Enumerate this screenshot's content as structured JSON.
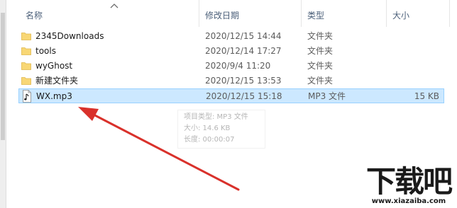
{
  "columns": {
    "name": "名称",
    "date_modified": "修改日期",
    "type": "类型",
    "size": "大小"
  },
  "files": [
    {
      "name": "2345Downloads",
      "date": "2020/12/15 14:44",
      "type": "文件夹",
      "size": "",
      "icon": "folder-icon",
      "selected": false
    },
    {
      "name": "tools",
      "date": "2020/12/14 17:27",
      "type": "文件夹",
      "size": "",
      "icon": "folder-icon",
      "selected": false
    },
    {
      "name": "wyGhost",
      "date": "2020/9/4 11:20",
      "type": "文件夹",
      "size": "",
      "icon": "folder-icon",
      "selected": false
    },
    {
      "name": "新建文件夹",
      "date": "2020/12/15 13:53",
      "type": "文件夹",
      "size": "",
      "icon": "folder-icon",
      "selected": false
    },
    {
      "name": "WX.mp3",
      "date": "2020/12/15 15:18",
      "type": "MP3 文件",
      "size": "15 KB",
      "icon": "music-file-icon",
      "selected": true
    }
  ],
  "tooltip": {
    "line1": "项目类型: MP3 文件",
    "line2": "大小: 14.6 KB",
    "line3": "长度: 00:00:07"
  },
  "watermark": {
    "logo": "下载吧",
    "url": "www.xiazaiba.com"
  },
  "colors": {
    "selection_bg": "#cce8ff",
    "selection_border": "#99d1ff",
    "folder": "#f8d775",
    "arrow": "#d9312b",
    "header_text": "#4c607a"
  }
}
